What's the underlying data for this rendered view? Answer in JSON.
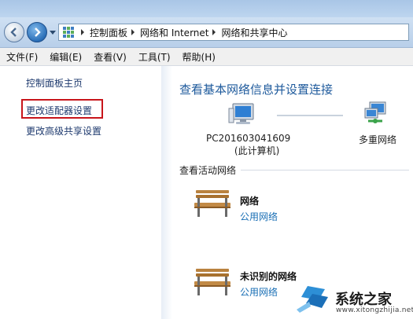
{
  "address_bar": {
    "breadcrumbs": [
      "控制面板",
      "网络和 Internet",
      "网络和共享中心"
    ]
  },
  "menu": {
    "items": [
      "文件(F)",
      "编辑(E)",
      "查看(V)",
      "工具(T)",
      "帮助(H)"
    ]
  },
  "sidebar": {
    "home_link": "控制面板主页",
    "adapter_link": "更改适配器设置",
    "sharing_link": "更改高级共享设置"
  },
  "main": {
    "title": "查看基本网络信息并设置连接",
    "computer_name": "PC201603041609",
    "computer_sub": "(此计算机)",
    "multi_network": "多重网络",
    "active_networks_label": "查看活动网络",
    "networks": [
      {
        "name": "网络",
        "type": "公用网络"
      },
      {
        "name": "未识别的网络",
        "type": "公用网络"
      }
    ]
  },
  "watermark": {
    "text": "系统之家",
    "url": "www.xitongzhijia.net"
  },
  "colors": {
    "link": "#1e3a6e",
    "title": "#1e5a9c",
    "network_type": "#1a6fb5",
    "highlight_box": "#c8151b"
  },
  "icons": [
    "back-arrow-icon",
    "forward-arrow-icon",
    "control-panel-icon",
    "computer-icon",
    "multi-network-icon",
    "bench-icon"
  ]
}
